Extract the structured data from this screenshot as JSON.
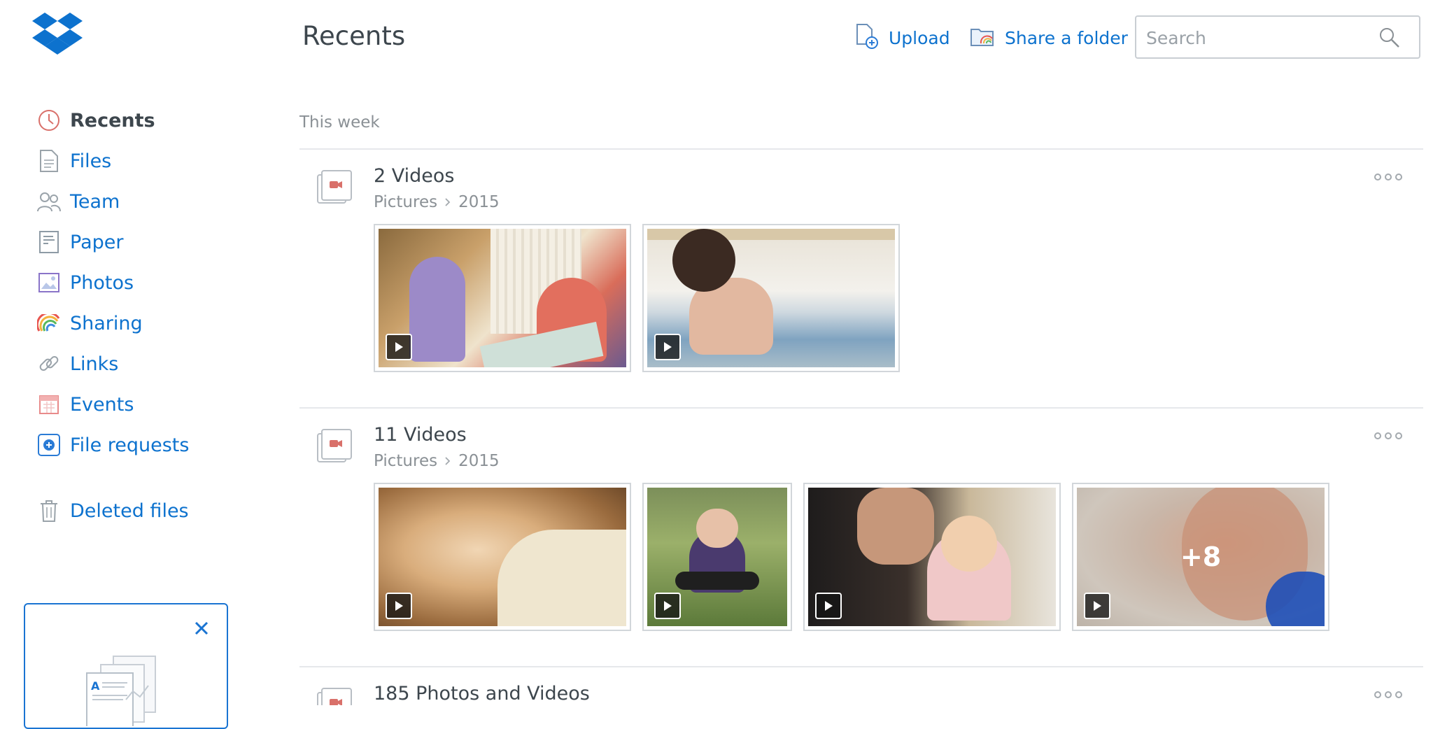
{
  "app": {
    "logo_icon": "dropbox-logo-icon",
    "accent_color": "#0d72ce"
  },
  "sidebar": {
    "items": [
      {
        "label": "Recents",
        "icon": "clock-icon",
        "active": true
      },
      {
        "label": "Files",
        "icon": "file-icon"
      },
      {
        "label": "Team",
        "icon": "team-icon"
      },
      {
        "label": "Paper",
        "icon": "paper-icon"
      },
      {
        "label": "Photos",
        "icon": "photo-icon"
      },
      {
        "label": "Sharing",
        "icon": "rainbow-icon"
      },
      {
        "label": "Links",
        "icon": "link-icon"
      },
      {
        "label": "Events",
        "icon": "calendar-icon"
      },
      {
        "label": "File requests",
        "icon": "file-request-icon"
      }
    ],
    "deleted": {
      "label": "Deleted files",
      "icon": "trash-icon"
    }
  },
  "header": {
    "title": "Recents",
    "upload_label": "Upload",
    "share_folder_label": "Share a folder",
    "search_placeholder": "Search"
  },
  "main": {
    "section_label": "This week",
    "groups": [
      {
        "title": "2 Videos",
        "path": [
          "Pictures",
          "2015"
        ],
        "thumb_count": 2
      },
      {
        "title": "11 Videos",
        "path": [
          "Pictures",
          "2015"
        ],
        "thumb_count": 4,
        "more_label": "+8"
      },
      {
        "title": "185 Photos and Videos"
      }
    ]
  }
}
